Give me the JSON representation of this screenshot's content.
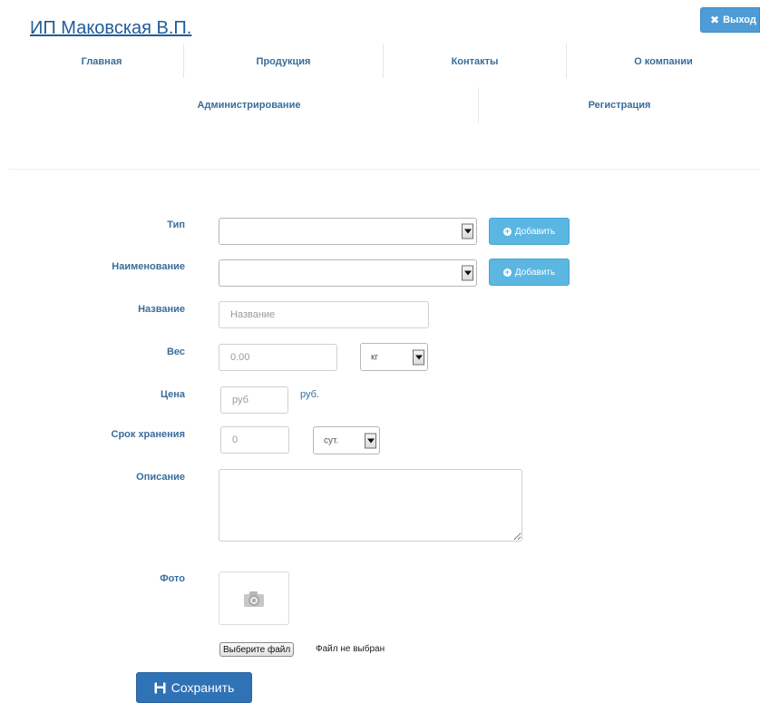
{
  "header": {
    "brand": "ИП Маковская В.П.",
    "logout_label": "Выход"
  },
  "nav": {
    "row1": [
      "Главная",
      "Продукция",
      "Контакты",
      "О компании"
    ],
    "row2": [
      "Администрирование",
      "Регистрация"
    ]
  },
  "form": {
    "type_label": "Тип",
    "name_label": "Наименование",
    "title_label": "Название",
    "title_placeholder": "Название",
    "weight_label": "Вес",
    "weight_placeholder": "0.00",
    "weight_unit": "кг",
    "price_label": "Цена",
    "price_placeholder": "руб",
    "price_unit": "руб.",
    "shelf_label": "Срок хранения",
    "shelf_placeholder": "0",
    "shelf_unit": "сут.",
    "desc_label": "Описание",
    "photo_label": "Фото",
    "add_label": "Добавить",
    "file_button": "Выберите файл",
    "file_status": "Файл не выбран",
    "save_label": "Сохранить"
  },
  "colors": {
    "primary": "#2f72b6",
    "info": "#5bb7e2",
    "label": "#3a6d9a",
    "brand": "#1f5c99"
  }
}
